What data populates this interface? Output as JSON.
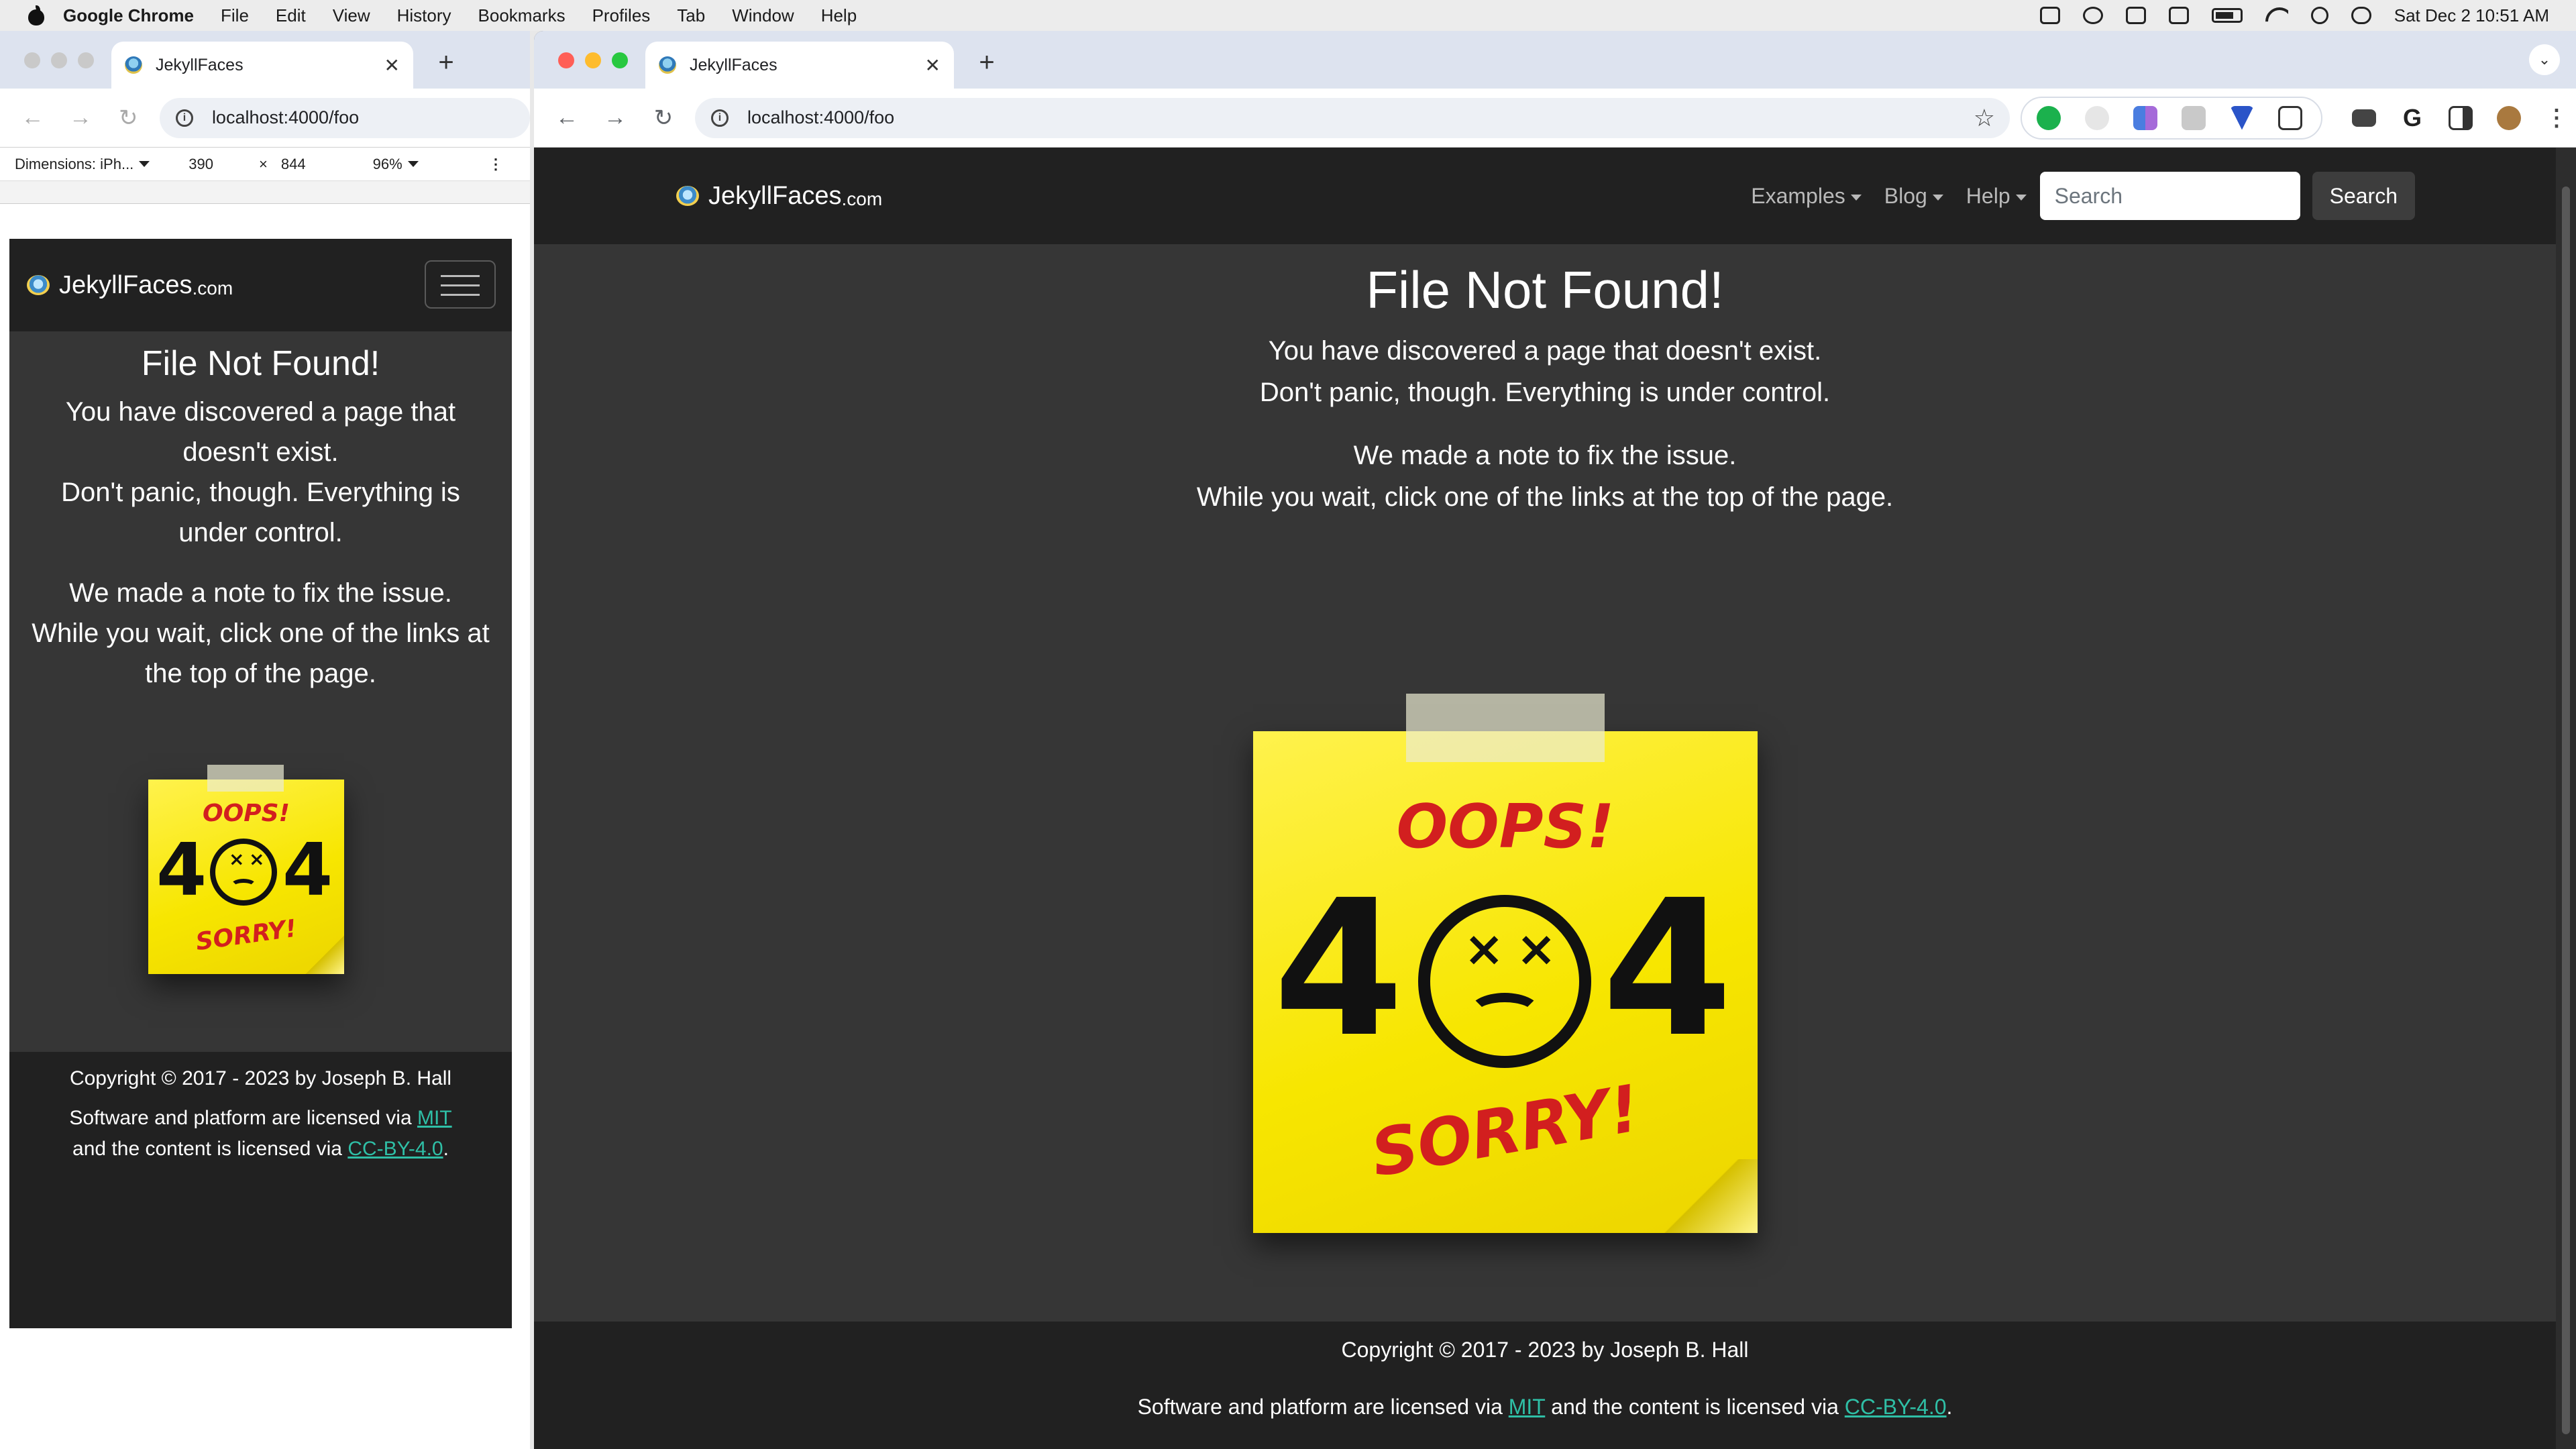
{
  "menubar": {
    "app": "Google Chrome",
    "items": [
      "File",
      "Edit",
      "View",
      "History",
      "Bookmarks",
      "Profiles",
      "Tab",
      "Window",
      "Help"
    ],
    "clock": "Sat Dec 2  10:51 AM"
  },
  "left_window": {
    "tab_title": "JekyllFaces",
    "url": "localhost:4000/foo",
    "devtools": {
      "device": "Dimensions: iPh...",
      "width": "390",
      "x": "×",
      "height": "844",
      "zoom": "96%"
    }
  },
  "main_window": {
    "tab_title": "JekyllFaces",
    "url": "localhost:4000/foo"
  },
  "site": {
    "brand_main": "JekyllFaces",
    "brand_suffix": ".com",
    "nav": {
      "examples": "Examples",
      "blog": "Blog",
      "help": "Help"
    },
    "search_placeholder": "Search",
    "search_button": "Search",
    "title": "File Not Found!",
    "line1": "You have discovered a page that doesn't exist.",
    "line2": "Don't panic, though. Everything is under control.",
    "line3": "We made a note to fix the issue.",
    "line4": "While you wait, click one of the links at the top of the page.",
    "note": {
      "oops": "OOPS!",
      "code_left": "4",
      "code_right": "4",
      "sorry": "SORRY!",
      "eye": "×"
    },
    "footer": {
      "copyright": "Copyright © 2017 - 2023 by Joseph B. Hall",
      "license_pre": "Software and platform are licensed via ",
      "mit": "MIT",
      "license_mid": " and the content is licensed via ",
      "cc": "CC-BY-4.0",
      "license_end": "."
    }
  }
}
